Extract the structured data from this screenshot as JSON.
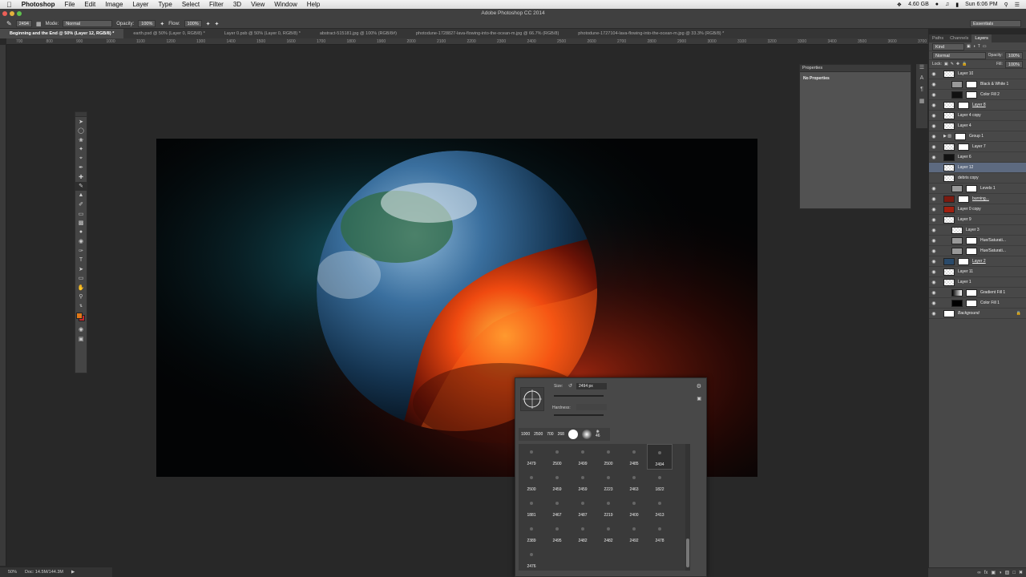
{
  "menubar": {
    "app": "Photoshop",
    "items": [
      "File",
      "Edit",
      "Image",
      "Layer",
      "Type",
      "Select",
      "Filter",
      "3D",
      "View",
      "Window",
      "Help"
    ],
    "memory": "4.60 GB",
    "time": "Sun 6:06 PM"
  },
  "window_title": "Adobe Photoshop CC 2014",
  "options": {
    "brush_size": "2494",
    "mode_label": "Mode:",
    "mode_value": "Normal",
    "opacity_label": "Opacity:",
    "opacity_value": "100%",
    "flow_label": "Flow:",
    "flow_value": "100%",
    "workspace": "Essentials"
  },
  "tabs": [
    "Beginning and the End @ 50% (Layer 12, RGB/8) *",
    "earth.psd @ 50% (Layer 0, RGB/8) *",
    "Layer 0.psb @ 50% (Layer 0, RGB/8) *",
    "abstract-515181.jpg @ 100% (RGB/8#)",
    "photodune-1728827-lava-flowing-into-the-ocean-m.jpg @ 66.7% (RGB/8)",
    "photodune-1727104-lava-flowing-into-the-ocean-m.jpg @ 33.3% (RGB/8) *"
  ],
  "ruler_ticks": [
    "700",
    "800",
    "900",
    "1000",
    "1100",
    "1200",
    "1300",
    "1400",
    "1500",
    "1600",
    "1700",
    "1800",
    "1900",
    "2000",
    "2100",
    "2200",
    "2300",
    "2400",
    "2500",
    "2600",
    "2700",
    "2800",
    "2900",
    "3000",
    "3100",
    "3200",
    "3300",
    "3400",
    "3500",
    "3600",
    "3700",
    "3800"
  ],
  "properties": {
    "title": "Properties",
    "body": "No Properties"
  },
  "layers_panel": {
    "tabs": [
      "Paths",
      "Channels",
      "Layers"
    ],
    "kind": "Kind",
    "blend": "Normal",
    "opacity_label": "Opacity:",
    "opacity": "100%",
    "lock_label": "Lock:",
    "fill_label": "Fill:",
    "fill": "100%",
    "layers": [
      {
        "name": "Layer 10"
      },
      {
        "name": "Black & White 1"
      },
      {
        "name": "Color Fill 2"
      },
      {
        "name": "Layer 8"
      },
      {
        "name": "Layer 4 copy"
      },
      {
        "name": "Layer 4"
      },
      {
        "name": "Group 1"
      },
      {
        "name": "Layer 7"
      },
      {
        "name": "Layer 6"
      },
      {
        "name": "Layer 12"
      },
      {
        "name": "debris copy"
      },
      {
        "name": "Levels 1"
      },
      {
        "name": "burning..."
      },
      {
        "name": "Layer 0 copy"
      },
      {
        "name": "Layer 9"
      },
      {
        "name": "Layer 3"
      },
      {
        "name": "Hue/Saturati..."
      },
      {
        "name": "Hue/Saturati..."
      },
      {
        "name": "Layer 2"
      },
      {
        "name": "Layer 11"
      },
      {
        "name": "Layer 1"
      },
      {
        "name": "Gradient Fill 1"
      },
      {
        "name": "Color Fill 1"
      },
      {
        "name": "Background"
      }
    ]
  },
  "status": {
    "zoom": "50%",
    "doc": "Doc: 14.5M/144.3M"
  },
  "brush_picker": {
    "size_label": "Size:",
    "size_value": "2494 px",
    "hardness_label": "Hardness:",
    "recent": [
      "1000",
      "2500",
      "700",
      "268",
      "46"
    ],
    "presets": [
      "2479",
      "2500",
      "2499",
      "2500",
      "2485",
      "2494",
      "2500",
      "2459",
      "2459",
      "2223",
      "2463",
      "1822",
      "1881",
      "2467",
      "2487",
      "2219",
      "2400",
      "2413",
      "2389",
      "2495",
      "2482",
      "2482",
      "2492",
      "2478",
      "2476"
    ]
  },
  "colors": {
    "foreground": "#e07818",
    "background": "#c0282a",
    "selected_layer": "#5d6a80"
  }
}
